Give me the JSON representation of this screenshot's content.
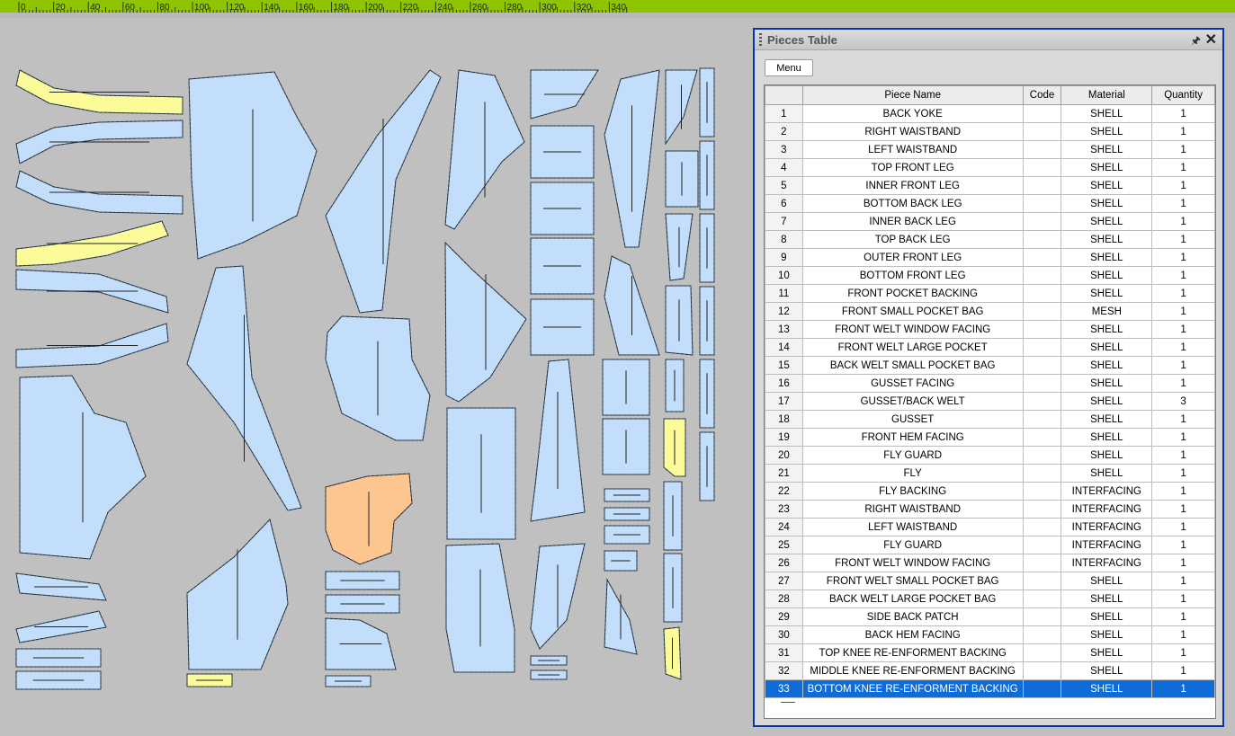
{
  "ruler": {
    "labels": [
      "0",
      "20",
      "40",
      "60",
      "80",
      "100",
      "120",
      "140",
      "160",
      "180",
      "200",
      "220",
      "240",
      "260",
      "280",
      "300",
      "320",
      "340"
    ]
  },
  "panel": {
    "title": "Pieces Table",
    "menu_label": "Menu",
    "columns": [
      "Piece Name",
      "Code",
      "Material",
      "Quantity"
    ],
    "selected_row": 33,
    "rows": [
      {
        "n": "1",
        "name": "BACK YOKE",
        "code": "",
        "material": "SHELL",
        "qty": "1"
      },
      {
        "n": "2",
        "name": "RIGHT WAISTBAND",
        "code": "",
        "material": "SHELL",
        "qty": "1"
      },
      {
        "n": "3",
        "name": "LEFT WAISTBAND",
        "code": "",
        "material": "SHELL",
        "qty": "1"
      },
      {
        "n": "4",
        "name": "TOP FRONT LEG",
        "code": "",
        "material": "SHELL",
        "qty": "1"
      },
      {
        "n": "5",
        "name": "INNER FRONT LEG",
        "code": "",
        "material": "SHELL",
        "qty": "1"
      },
      {
        "n": "6",
        "name": "BOTTOM BACK LEG",
        "code": "",
        "material": "SHELL",
        "qty": "1"
      },
      {
        "n": "7",
        "name": "INNER BACK LEG",
        "code": "",
        "material": "SHELL",
        "qty": "1"
      },
      {
        "n": "8",
        "name": "TOP BACK LEG",
        "code": "",
        "material": "SHELL",
        "qty": "1"
      },
      {
        "n": "9",
        "name": "OUTER FRONT LEG",
        "code": "",
        "material": "SHELL",
        "qty": "1"
      },
      {
        "n": "10",
        "name": "BOTTOM FRONT LEG",
        "code": "",
        "material": "SHELL",
        "qty": "1"
      },
      {
        "n": "11",
        "name": "FRONT POCKET BACKING",
        "code": "",
        "material": "SHELL",
        "qty": "1"
      },
      {
        "n": "12",
        "name": "FRONT SMALL POCKET BAG",
        "code": "",
        "material": "MESH",
        "qty": "1"
      },
      {
        "n": "13",
        "name": "FRONT WELT WINDOW FACING",
        "code": "",
        "material": "SHELL",
        "qty": "1"
      },
      {
        "n": "14",
        "name": "FRONT WELT LARGE POCKET",
        "code": "",
        "material": "SHELL",
        "qty": "1"
      },
      {
        "n": "15",
        "name": "BACK WELT SMALL POCKET BAG",
        "code": "",
        "material": "SHELL",
        "qty": "1"
      },
      {
        "n": "16",
        "name": "GUSSET FACING",
        "code": "",
        "material": "SHELL",
        "qty": "1"
      },
      {
        "n": "17",
        "name": "GUSSET/BACK WELT",
        "code": "",
        "material": "SHELL",
        "qty": "3"
      },
      {
        "n": "18",
        "name": "GUSSET",
        "code": "",
        "material": "SHELL",
        "qty": "1"
      },
      {
        "n": "19",
        "name": "FRONT HEM FACING",
        "code": "",
        "material": "SHELL",
        "qty": "1"
      },
      {
        "n": "20",
        "name": "FLY GUARD",
        "code": "",
        "material": "SHELL",
        "qty": "1"
      },
      {
        "n": "21",
        "name": "FLY",
        "code": "",
        "material": "SHELL",
        "qty": "1"
      },
      {
        "n": "22",
        "name": "FLY BACKING",
        "code": "",
        "material": "INTERFACING",
        "qty": "1"
      },
      {
        "n": "23",
        "name": "RIGHT WAISTBAND",
        "code": "",
        "material": "INTERFACING",
        "qty": "1"
      },
      {
        "n": "24",
        "name": "LEFT WAISTBAND",
        "code": "",
        "material": "INTERFACING",
        "qty": "1"
      },
      {
        "n": "25",
        "name": "FLY GUARD",
        "code": "",
        "material": "INTERFACING",
        "qty": "1"
      },
      {
        "n": "26",
        "name": "FRONT WELT WINDOW FACING",
        "code": "",
        "material": "INTERFACING",
        "qty": "1"
      },
      {
        "n": "27",
        "name": "FRONT WELT SMALL POCKET BAG",
        "code": "",
        "material": "SHELL",
        "qty": "1"
      },
      {
        "n": "28",
        "name": "BACK WELT LARGE POCKET BAG",
        "code": "",
        "material": "SHELL",
        "qty": "1"
      },
      {
        "n": "29",
        "name": "SIDE BACK PATCH",
        "code": "",
        "material": "SHELL",
        "qty": "1"
      },
      {
        "n": "30",
        "name": "BACK HEM FACING",
        "code": "",
        "material": "SHELL",
        "qty": "1"
      },
      {
        "n": "31",
        "name": "TOP KNEE RE-ENFORMENT BACKING",
        "code": "",
        "material": "SHELL",
        "qty": "1"
      },
      {
        "n": "32",
        "name": "MIDDLE KNEE RE-ENFORMENT BACKING",
        "code": "",
        "material": "SHELL",
        "qty": "1"
      },
      {
        "n": "33",
        "name": "BOTTOM KNEE RE-ENFORMENT BACKING",
        "code": "",
        "material": "SHELL",
        "qty": "1"
      }
    ]
  },
  "colors": {
    "ruler": "#8fc400",
    "canvas_bg": "#c0c0c0",
    "piece_blue": "#c3defa",
    "piece_yellow": "#fbfb9a",
    "piece_orange": "#fdc690",
    "selection": "#0d6cd8",
    "panel_border": "#0a34a8"
  },
  "icons": {
    "pin": "pin-icon",
    "close": "close-icon"
  }
}
